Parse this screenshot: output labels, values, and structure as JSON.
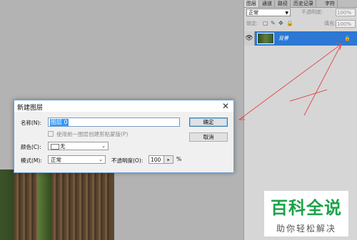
{
  "layers_panel": {
    "tabs": [
      "图层",
      "通道",
      "路径",
      "历史记录",
      "字符"
    ],
    "blend_mode": "正常",
    "opacity_label": "不透明度:",
    "opacity_value": "100%",
    "lock_label": "锁定:",
    "fill_label": "填充:",
    "fill_value": "100%",
    "layer": {
      "name": "背景",
      "lock": "🔒"
    }
  },
  "dialog": {
    "title": "新建图层",
    "close": "✕",
    "name_label": "名称(N):",
    "name_value": "图层 0",
    "clip_label": "使用前一图层创建剪贴蒙版(P)",
    "color_label": "颜色(C):",
    "color_value": "无",
    "mode_label": "模式(M):",
    "mode_value": "正常",
    "opacity_label": "不透明度(O):",
    "opacity_value": "100",
    "percent": "%",
    "ok": "确定",
    "cancel": "取消"
  },
  "watermark": {
    "main": "百科全说",
    "sub": "助你轻松解决"
  },
  "colors": {
    "selection": "#2c78d4",
    "annotation": "#e05050",
    "watermark_green": "#1aa34a"
  }
}
